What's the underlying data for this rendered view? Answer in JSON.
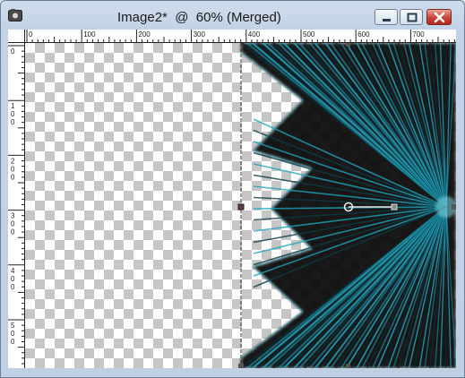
{
  "window": {
    "title": "Image2*  @  60% (Merged)",
    "controls": {
      "minimize": "minimize",
      "maximize": "maximize",
      "close": "close"
    }
  },
  "ruler_horizontal": {
    "labels": [
      "0",
      "100",
      "200",
      "300",
      "400",
      "500",
      "600",
      "700"
    ]
  },
  "ruler_vertical": {
    "labels": [
      "0",
      "1 0 0",
      "2 0 0",
      "3 0 0",
      "4 0 0",
      "5 0 0"
    ]
  },
  "colors": {
    "accent_teal": "#1fa3bd",
    "dark": "#050a0c",
    "checker_gray": "#c6c6c6"
  },
  "icons": {
    "app": "app-icon",
    "rotate_handle": "rotate-handle-icon"
  }
}
